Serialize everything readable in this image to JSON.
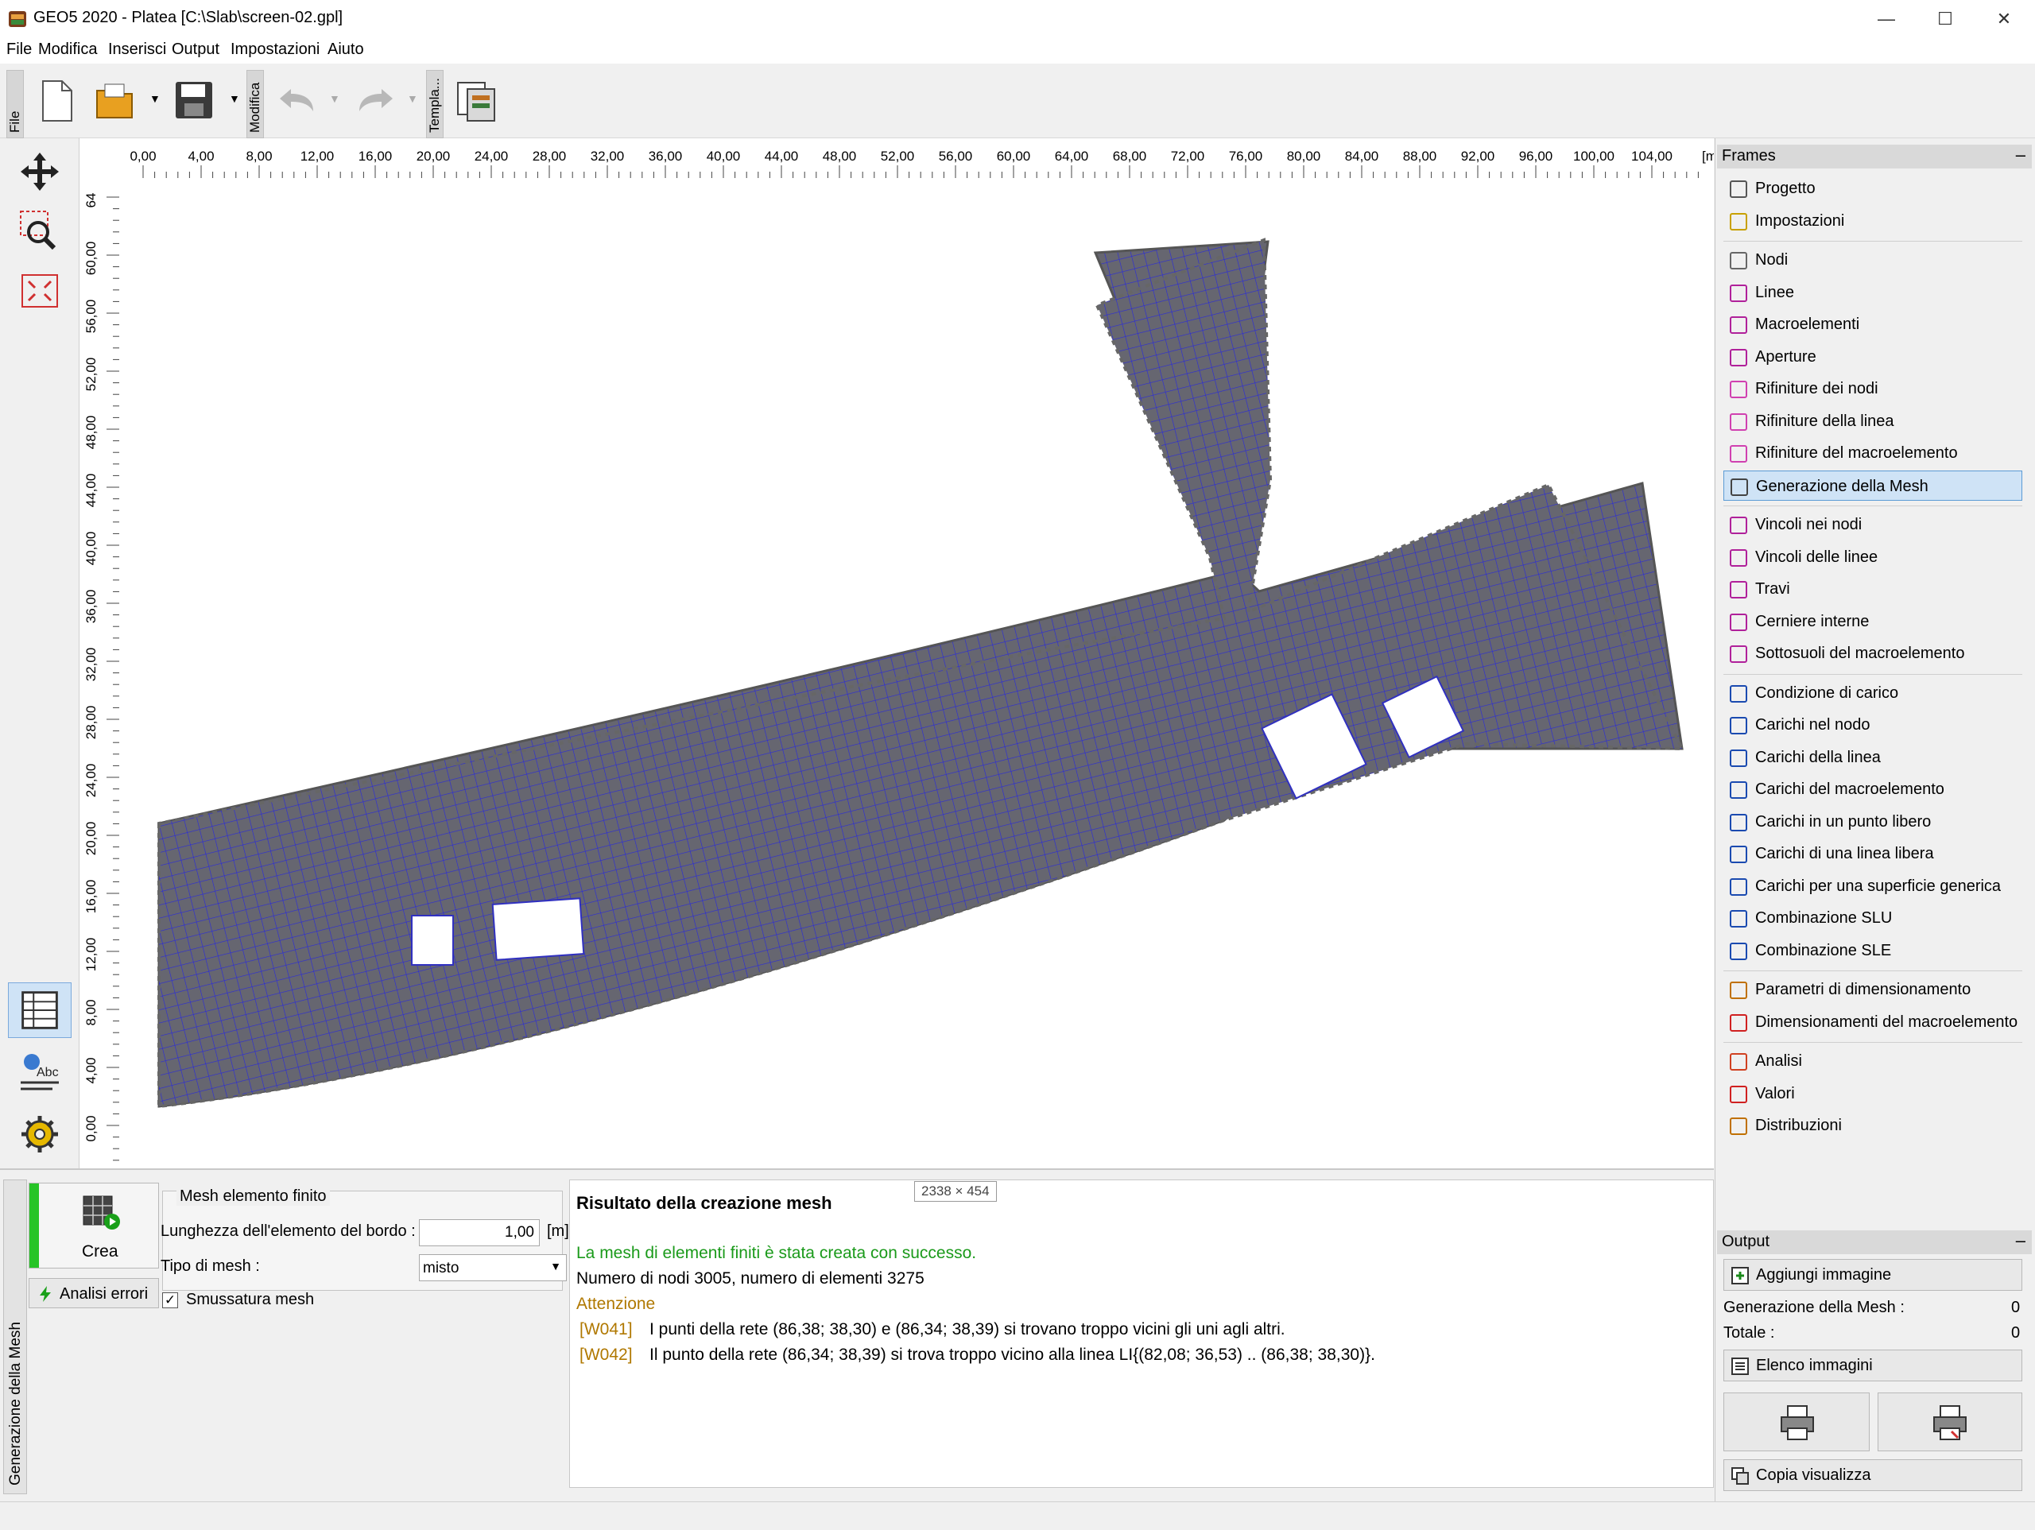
{
  "window": {
    "title": "GEO5 2020 - Platea [C:\\Slab\\screen-02.gpl]",
    "min": "—",
    "max": "☐",
    "close": "✕"
  },
  "menu": [
    "File",
    "Modifica",
    "Inserisci",
    "Output",
    "Impostazioni",
    "Aiuto"
  ],
  "toolbar": {
    "file_tab": "File",
    "modifica_tab": "Modifica",
    "templates_tab": "Templa..."
  },
  "ruler": {
    "x_labels": [
      "0,00",
      "4,00",
      "8,00",
      "12,00",
      "16,00",
      "20,00",
      "24,00",
      "28,00",
      "32,00",
      "36,00",
      "40,00",
      "44,00",
      "48,00",
      "52,00",
      "56,00",
      "60,00",
      "64,00",
      "68,00",
      "72,00",
      "76,00",
      "80,00",
      "84,00",
      "88,00",
      "92,00",
      "96,00",
      "100,00",
      "104,00"
    ],
    "unit": "[m]",
    "y_labels": [
      "64",
      "60,00",
      "56,00",
      "52,00",
      "48,00",
      "44,00",
      "40,00",
      "36,00",
      "32,00",
      "28,00",
      "24,00",
      "20,00",
      "16,00",
      "12,00",
      "8,00",
      "4,00",
      "0,00",
      "0"
    ]
  },
  "frames": {
    "header": "Frames",
    "collapse": "–",
    "groups": [
      [
        {
          "label": "Progetto",
          "icon": "project-icon"
        },
        {
          "label": "Impostazioni",
          "icon": "settings-gear-icon"
        }
      ],
      [
        {
          "label": "Nodi",
          "icon": "nodes-icon"
        },
        {
          "label": "Linee",
          "icon": "lines-icon"
        },
        {
          "label": "Macroelementi",
          "icon": "macroelements-icon"
        },
        {
          "label": "Aperture",
          "icon": "openings-icon"
        },
        {
          "label": "Rifiniture dei nodi",
          "icon": "node-refinement-icon"
        },
        {
          "label": "Rifiniture della linea",
          "icon": "line-refinement-icon"
        },
        {
          "label": "Rifiniture del macroelemento",
          "icon": "macro-refinement-icon"
        },
        {
          "label": "Generazione della Mesh",
          "icon": "mesh-generation-icon",
          "selected": true
        }
      ],
      [
        {
          "label": "Vincoli nei nodi",
          "icon": "node-supports-icon"
        },
        {
          "label": "Vincoli delle linee",
          "icon": "line-supports-icon"
        },
        {
          "label": "Travi",
          "icon": "beams-icon"
        },
        {
          "label": "Cerniere interne",
          "icon": "internal-hinges-icon"
        },
        {
          "label": "Sottosuoli del macroelemento",
          "icon": "subsoils-icon"
        }
      ],
      [
        {
          "label": "Condizione di carico",
          "icon": "load-case-icon"
        },
        {
          "label": "Carichi nel nodo",
          "icon": "node-loads-icon"
        },
        {
          "label": "Carichi della linea",
          "icon": "line-loads-icon"
        },
        {
          "label": "Carichi del macroelemento",
          "icon": "macro-loads-icon"
        },
        {
          "label": "Carichi in un punto libero",
          "icon": "free-point-loads-icon"
        },
        {
          "label": "Carichi di una linea libera",
          "icon": "free-line-loads-icon"
        },
        {
          "label": "Carichi per una superficie generica",
          "icon": "surface-loads-icon"
        },
        {
          "label": "Combinazione SLU",
          "icon": "combination-slu-icon"
        },
        {
          "label": "Combinazione SLE",
          "icon": "combination-sle-icon"
        }
      ],
      [
        {
          "label": "Parametri di dimensionamento",
          "icon": "design-parameters-icon"
        },
        {
          "label": "Dimensionamenti del macroelemento",
          "icon": "macro-design-icon"
        }
      ],
      [
        {
          "label": "Analisi",
          "icon": "analysis-icon"
        },
        {
          "label": "Valori",
          "icon": "values-icon"
        },
        {
          "label": "Distribuzioni",
          "icon": "distributions-icon"
        }
      ]
    ]
  },
  "output": {
    "header": "Output",
    "collapse": "–",
    "add_image": "Aggiungi immagine",
    "mesh_label": "Generazione della Mesh :",
    "mesh_count": "0",
    "total_label": "Totale :",
    "total_count": "0",
    "image_list": "Elenco immagini",
    "copy_view": "Copia  visualizza"
  },
  "bottom": {
    "vertical_tab": "Generazione della Mesh",
    "crea": "Crea",
    "analisi_errori": "Analisi errori",
    "group_title": "Mesh elemento finito",
    "edge_length_label": "Lunghezza dell'elemento del bordo  :",
    "edge_length_value": "1,00",
    "edge_length_unit": "[m]",
    "mesh_type_label": "Tipo di mesh :",
    "mesh_type_value": "misto",
    "smoothing_label": "Smussatura mesh",
    "smoothing_checked": true,
    "size_tooltip": "2338 × 454"
  },
  "result": {
    "title": "Risultato della creazione mesh",
    "success": "La mesh di elementi finiti è stata creata con successo.",
    "stats": "Numero di nodi 3005, numero di elementi 3275",
    "warning_header": "Attenzione",
    "warnings": [
      {
        "code": "[W041]",
        "text": "I punti della rete (86,38; 38,30) e (86,34; 38,39) si trovano troppo vicini gli uni agli altri."
      },
      {
        "code": "[W042]",
        "text": "Il punto della rete (86,34; 38,39) si trova troppo vicino alla linea LI{(82,08; 36,53) .. (86,38; 38,30)}."
      }
    ]
  },
  "colors": {
    "mesh_fill": "#666670",
    "mesh_lines": "#2b2bd8",
    "success": "#1a9a1a",
    "warning": "#b07800",
    "selection": "#cfe3f6",
    "crea_bar": "#27c427"
  }
}
